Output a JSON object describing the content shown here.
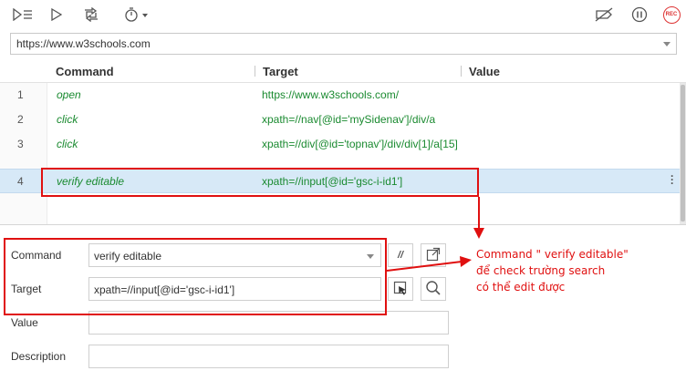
{
  "toolbar": {
    "icons": [
      "run-all-icon",
      "run-icon",
      "step-icon",
      "timer-icon",
      "disable-breakpoints-icon",
      "pause-icon",
      "record-icon"
    ],
    "record_label": "REC"
  },
  "url": {
    "value": "https://www.w3schools.com"
  },
  "table": {
    "headers": {
      "command": "Command",
      "target": "Target",
      "value": "Value"
    },
    "rows": [
      {
        "num": "1",
        "command": "open",
        "target": "https://www.w3schools.com/",
        "value": ""
      },
      {
        "num": "2",
        "command": "click",
        "target": "xpath=//nav[@id='mySidenav']/div/a",
        "value": ""
      },
      {
        "num": "3",
        "command": "click",
        "target": "xpath=//div[@id='topnav']/div/div[1]/a[15]",
        "value": ""
      },
      {
        "num": "4",
        "command": "verify editable",
        "target": "xpath=//input[@id='gsc-i-id1']",
        "value": ""
      }
    ],
    "selected_row": 4
  },
  "form": {
    "command_label": "Command",
    "command_value": "verify editable",
    "target_label": "Target",
    "target_value": "xpath=//input[@id='gsc-i-id1']",
    "value_label": "Value",
    "value_value": "",
    "description_label": "Description",
    "description_value": "",
    "comment_toggle": "//"
  },
  "annotation": {
    "lines": [
      "Command \" verify editable\"",
      "để check trường search",
      "có thể edit được"
    ]
  },
  "colors": {
    "command_text": "#1a8a30",
    "selected_row": "#d7e9f7",
    "annotation": "#e01010"
  }
}
